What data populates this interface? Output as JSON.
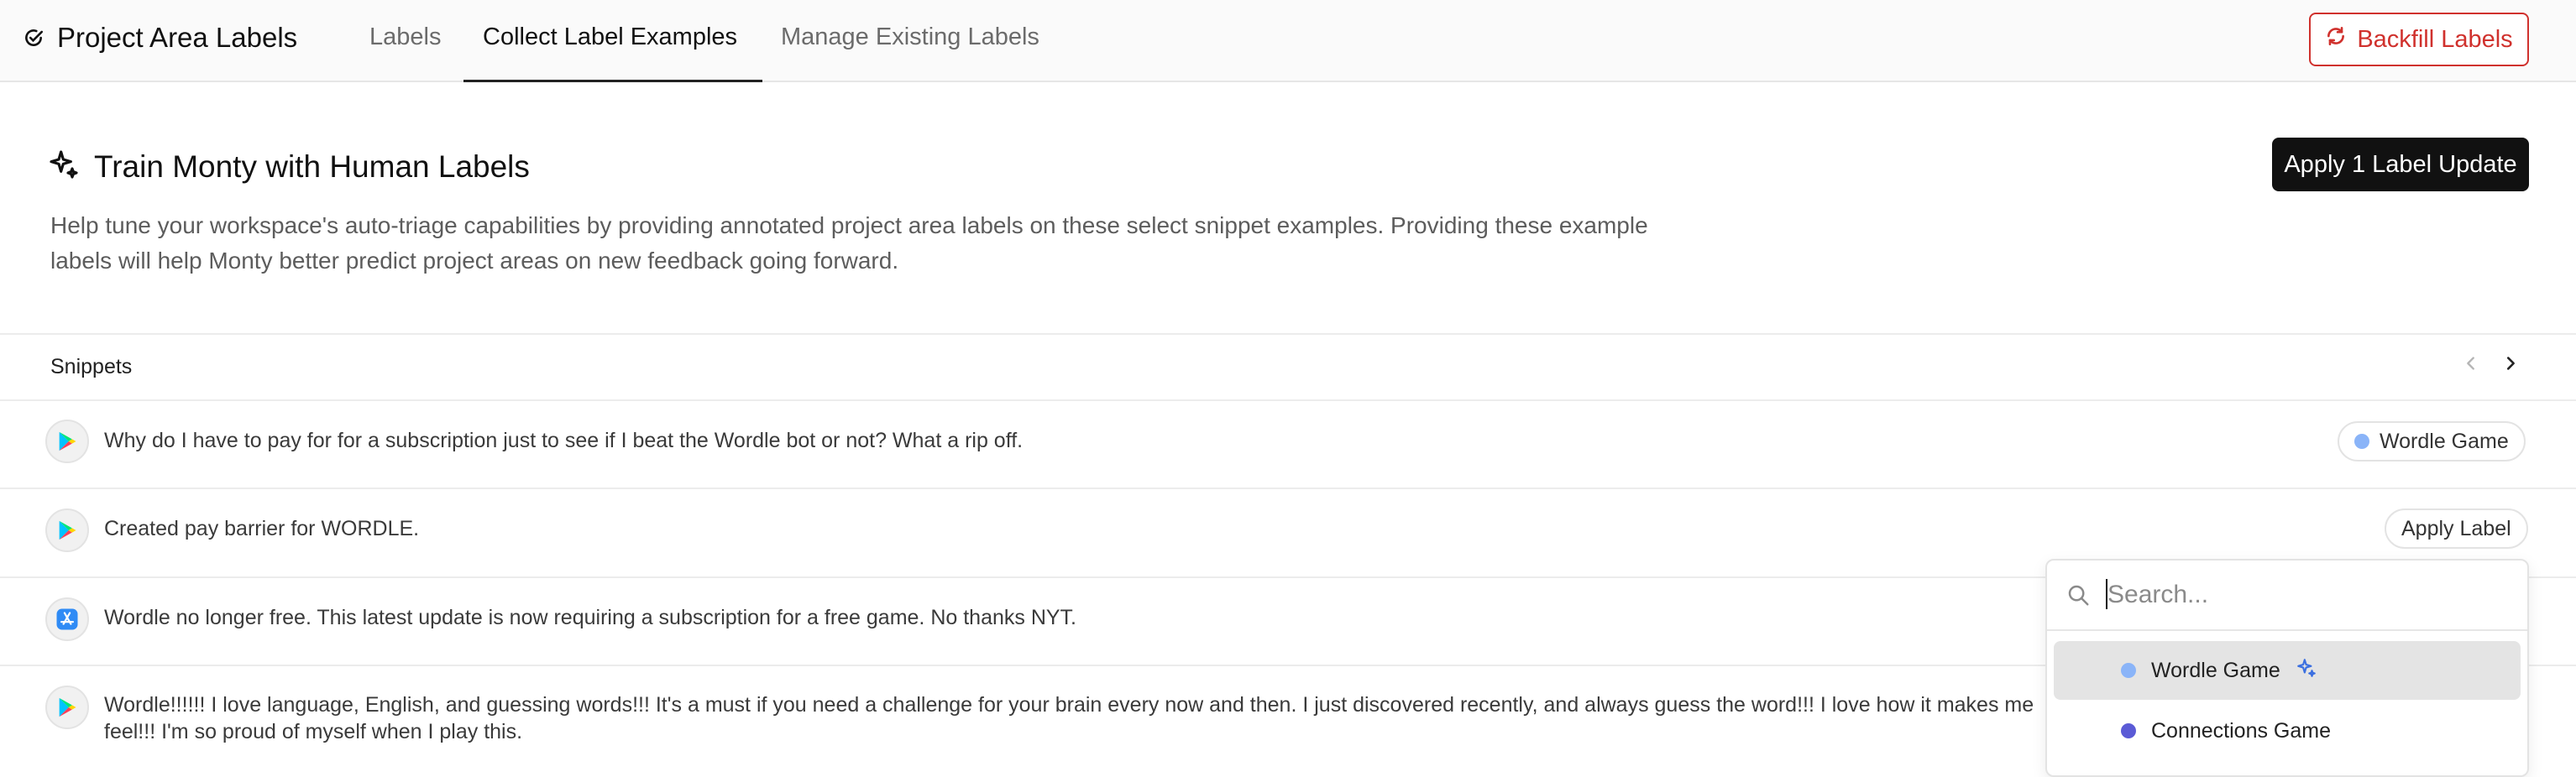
{
  "app": {
    "title": "Project Area Labels"
  },
  "tabs": [
    {
      "label": "Labels",
      "active": false
    },
    {
      "label": "Collect Label Examples",
      "active": true
    },
    {
      "label": "Manage Existing Labels",
      "active": false
    }
  ],
  "header_actions": {
    "backfill_label": "Backfill Labels"
  },
  "main": {
    "title": "Train Monty with Human Labels",
    "description_line1": "Help tune your workspace's auto-triage capabilities by providing annotated project area labels on these select snippet examples. Providing these example",
    "description_line2": "labels will help Monty better predict project areas on new feedback going forward.",
    "apply_button_label": "Apply 1 Label Update"
  },
  "snippets": {
    "heading": "Snippets",
    "rows": [
      {
        "source_icon": "google-play-icon",
        "text": "Why do I have to pay for for a subscription just to see if I beat the Wordle bot or not? What a rip off.",
        "label": "Wordle Game",
        "label_color": "#8ab4f8"
      },
      {
        "source_icon": "google-play-icon",
        "text": "Created pay barrier for WORDLE.",
        "action_label": "Apply Label"
      },
      {
        "source_icon": "app-store-icon",
        "text": "Wordle no longer free. This latest update is now requiring a subscription for a free game. No thanks NYT."
      },
      {
        "source_icon": "google-play-icon",
        "text_line1": "Wordle!!!!!! I love language, English, and guessing words!!! It's a must if you need a challenge for your brain every now and then. I just discovered recently, and always guess the word!!! I love how it makes me",
        "text_line2": "feel!!! I'm so proud of myself when I play this."
      }
    ]
  },
  "dropdown": {
    "search_placeholder": "Search...",
    "search_value": "",
    "options": [
      {
        "label": "Wordle Game",
        "color": "#8ab4f8",
        "highlighted": true,
        "suggested": true
      },
      {
        "label": "Connections Game",
        "color": "#5b5bd6",
        "highlighted": false
      }
    ]
  },
  "colors": {
    "accent_red": "#d0312d",
    "primary_button": "#111111"
  }
}
